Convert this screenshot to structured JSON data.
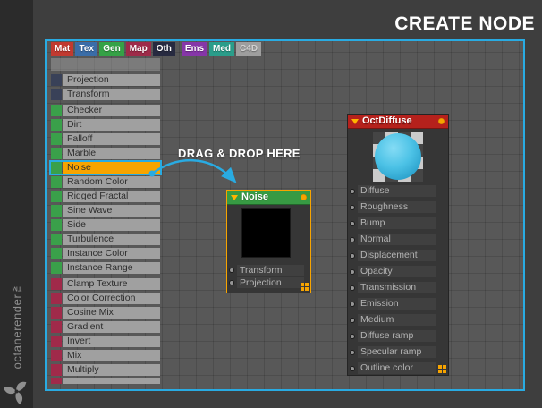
{
  "page": {
    "title": "CREATE NODE"
  },
  "branding": {
    "logo_text": "octanerender™",
    "logo_icon": "octane-pinwheel-logo"
  },
  "annotation": {
    "drag_label": "DRAG & DROP HERE"
  },
  "colors": {
    "accent_cyan": "#29abe2",
    "selection_orange": "#f7a400",
    "panel_background": "#585858",
    "outer_background": "#3e3e3e",
    "list_row_gray": "#a0a0a0"
  },
  "create_panel": {
    "tabs": [
      {
        "label": "Mat",
        "color": "#c13a30"
      },
      {
        "label": "Tex",
        "color": "#3a6da8"
      },
      {
        "label": "Gen",
        "color": "#35a246"
      },
      {
        "label": "Map",
        "color": "#9e2b49"
      },
      {
        "label": "Oth",
        "color": "#272a40"
      },
      {
        "label": "Ems",
        "color": "#8636a8",
        "gap_before": true
      },
      {
        "label": "Med",
        "color": "#2a9d8a"
      },
      {
        "label": "C4D",
        "color": "#9e9e9e",
        "text_color": "#d2d2d2"
      }
    ],
    "ghost_row": {
      "label": ""
    },
    "node_list": {
      "selected": "Noise",
      "sections": [
        {
          "name": "coordinates",
          "icon_color": "#394158",
          "items": [
            "Projection",
            "Transform"
          ]
        },
        {
          "name": "generators",
          "icon_color": "#3aa04a",
          "items": [
            "Checker",
            "Dirt",
            "Falloff",
            "Marble",
            "Noise",
            "Random Color",
            "Ridged Fractal",
            "Sine Wave",
            "Side",
            "Turbulence",
            "Instance Color",
            "Instance Range"
          ]
        },
        {
          "name": "operators",
          "icon_color": "#a02a4a",
          "items": [
            "Clamp Texture",
            "Color Correction",
            "Cosine Mix",
            "Gradient",
            "Invert",
            "Mix",
            "Multiply"
          ]
        }
      ],
      "partial_row_clipped": true
    }
  },
  "nodes": {
    "noise": {
      "title": "Noise",
      "header_color": "#379a43",
      "selected": true,
      "preview": "black-swatch",
      "inputs": [
        "Transform",
        "Projection"
      ]
    },
    "octdiffuse": {
      "title": "OctDiffuse",
      "header_color": "#b5211c",
      "selected": false,
      "preview": "blue-sphere-on-checker",
      "inputs": [
        "Diffuse",
        "Roughness",
        "Bump",
        "Normal",
        "Displacement",
        "Opacity",
        "Transmission",
        "Emission",
        "Medium",
        "Diffuse ramp",
        "Specular ramp",
        "Outline color"
      ]
    }
  }
}
